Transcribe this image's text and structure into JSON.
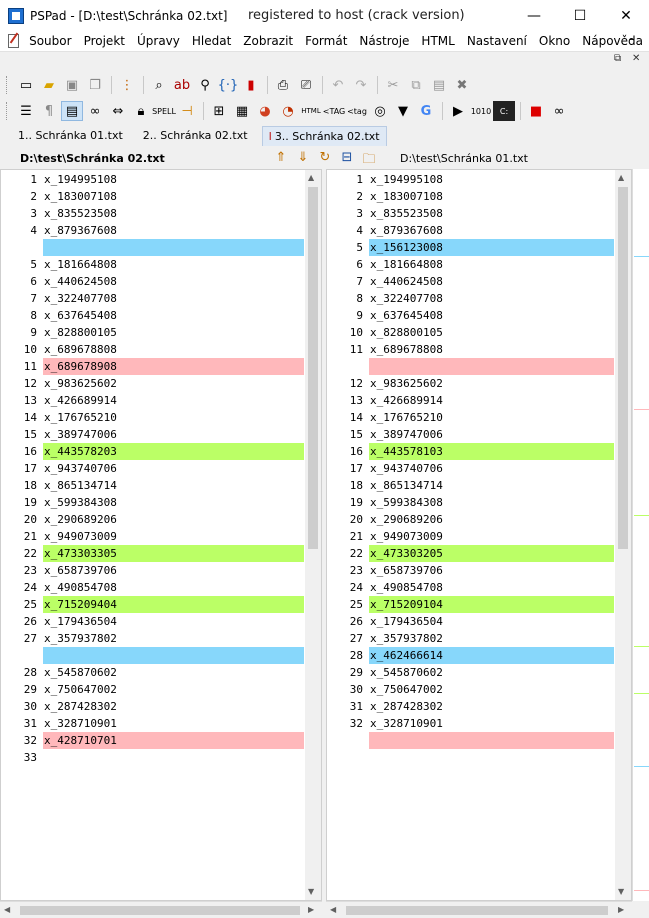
{
  "window": {
    "title": "PSPad - [D:\\test\\Schránka 02.txt]",
    "title_center": "registered to host (crack version)",
    "minimize_glyph": "—",
    "maximize_glyph": "☐",
    "close_glyph": "✕"
  },
  "menu": {
    "items": [
      "Soubor",
      "Projekt",
      "Úpravy",
      "Hledat",
      "Zobrazit",
      "Formát",
      "Nástroje",
      "HTML",
      "Nastavení",
      "Okno",
      "Nápověda"
    ],
    "mdi_min": "–"
  },
  "tabs": [
    {
      "label": "1.. Schránka 01.txt",
      "active": false
    },
    {
      "label": "2.. Schránka 02.txt",
      "active": false
    },
    {
      "label": "3.. Schránka 02.txt",
      "active": true
    }
  ],
  "paths": {
    "left": "D:\\test\\Schránka 02.txt",
    "right": "D:\\test\\Schránka 01.txt"
  },
  "colors": {
    "blue": "#87d7fb",
    "red": "#ffb8bb",
    "green": "#bbff66"
  },
  "left_lines": [
    {
      "n": "1",
      "t": "x_194995108",
      "hl": ""
    },
    {
      "n": "2",
      "t": "x_183007108",
      "hl": ""
    },
    {
      "n": "3",
      "t": "x_835523508",
      "hl": ""
    },
    {
      "n": "4",
      "t": "x_879367608",
      "hl": ""
    },
    {
      "n": "",
      "t": "",
      "hl": "blue"
    },
    {
      "n": "5",
      "t": "x_181664808",
      "hl": ""
    },
    {
      "n": "6",
      "t": "x_440624508",
      "hl": ""
    },
    {
      "n": "7",
      "t": "x_322407708",
      "hl": ""
    },
    {
      "n": "8",
      "t": "x_637645408",
      "hl": ""
    },
    {
      "n": "9",
      "t": "x_828800105",
      "hl": ""
    },
    {
      "n": "10",
      "t": "x_689678808",
      "hl": ""
    },
    {
      "n": "11",
      "t": "x_689678908",
      "hl": "red"
    },
    {
      "n": "12",
      "t": "x_983625602",
      "hl": ""
    },
    {
      "n": "13",
      "t": "x_426689914",
      "hl": ""
    },
    {
      "n": "14",
      "t": "x_176765210",
      "hl": ""
    },
    {
      "n": "15",
      "t": "x_389747006",
      "hl": ""
    },
    {
      "n": "16",
      "t": "x_443578203",
      "hl": "green"
    },
    {
      "n": "17",
      "t": "x_943740706",
      "hl": ""
    },
    {
      "n": "18",
      "t": "x_865134714",
      "hl": ""
    },
    {
      "n": "19",
      "t": "x_599384308",
      "hl": ""
    },
    {
      "n": "20",
      "t": "x_290689206",
      "hl": ""
    },
    {
      "n": "21",
      "t": "x_949073009",
      "hl": ""
    },
    {
      "n": "22",
      "t": "x_473303305",
      "hl": "green"
    },
    {
      "n": "23",
      "t": "x_658739706",
      "hl": ""
    },
    {
      "n": "24",
      "t": "x_490854708",
      "hl": ""
    },
    {
      "n": "25",
      "t": "x_715209404",
      "hl": "green"
    },
    {
      "n": "26",
      "t": "x_179436504",
      "hl": ""
    },
    {
      "n": "27",
      "t": "x_357937802",
      "hl": ""
    },
    {
      "n": "",
      "t": "",
      "hl": "blue"
    },
    {
      "n": "28",
      "t": "x_545870602",
      "hl": ""
    },
    {
      "n": "29",
      "t": "x_750647002",
      "hl": ""
    },
    {
      "n": "30",
      "t": "x_287428302",
      "hl": ""
    },
    {
      "n": "31",
      "t": "x_328710901",
      "hl": ""
    },
    {
      "n": "32",
      "t": "x_428710701",
      "hl": "red"
    },
    {
      "n": "33",
      "t": "",
      "hl": ""
    }
  ],
  "right_lines": [
    {
      "n": "1",
      "t": "x_194995108",
      "hl": ""
    },
    {
      "n": "2",
      "t": "x_183007108",
      "hl": ""
    },
    {
      "n": "3",
      "t": "x_835523508",
      "hl": ""
    },
    {
      "n": "4",
      "t": "x_879367608",
      "hl": ""
    },
    {
      "n": "5",
      "t": "x_156123008",
      "hl": "blue"
    },
    {
      "n": "6",
      "t": "x_181664808",
      "hl": ""
    },
    {
      "n": "7",
      "t": "x_440624508",
      "hl": ""
    },
    {
      "n": "8",
      "t": "x_322407708",
      "hl": ""
    },
    {
      "n": "9",
      "t": "x_637645408",
      "hl": ""
    },
    {
      "n": "10",
      "t": "x_828800105",
      "hl": ""
    },
    {
      "n": "11",
      "t": "x_689678808",
      "hl": ""
    },
    {
      "n": "",
      "t": "",
      "hl": "red"
    },
    {
      "n": "12",
      "t": "x_983625602",
      "hl": ""
    },
    {
      "n": "13",
      "t": "x_426689914",
      "hl": ""
    },
    {
      "n": "14",
      "t": "x_176765210",
      "hl": ""
    },
    {
      "n": "15",
      "t": "x_389747006",
      "hl": ""
    },
    {
      "n": "16",
      "t": "x_443578103",
      "hl": "green"
    },
    {
      "n": "17",
      "t": "x_943740706",
      "hl": ""
    },
    {
      "n": "18",
      "t": "x_865134714",
      "hl": ""
    },
    {
      "n": "19",
      "t": "x_599384308",
      "hl": ""
    },
    {
      "n": "20",
      "t": "x_290689206",
      "hl": ""
    },
    {
      "n": "21",
      "t": "x_949073009",
      "hl": ""
    },
    {
      "n": "22",
      "t": "x_473303205",
      "hl": "green"
    },
    {
      "n": "23",
      "t": "x_658739706",
      "hl": ""
    },
    {
      "n": "24",
      "t": "x_490854708",
      "hl": ""
    },
    {
      "n": "25",
      "t": "x_715209104",
      "hl": "green"
    },
    {
      "n": "26",
      "t": "x_179436504",
      "hl": ""
    },
    {
      "n": "27",
      "t": "x_357937802",
      "hl": ""
    },
    {
      "n": "28",
      "t": "x_462466614",
      "hl": "blue"
    },
    {
      "n": "29",
      "t": "x_545870602",
      "hl": ""
    },
    {
      "n": "30",
      "t": "x_750647002",
      "hl": ""
    },
    {
      "n": "31",
      "t": "x_287428302",
      "hl": ""
    },
    {
      "n": "32",
      "t": "x_328710901",
      "hl": ""
    },
    {
      "n": "",
      "t": "",
      "hl": "red"
    }
  ],
  "overview_marks": [
    {
      "pos": 0.12,
      "color": "blue"
    },
    {
      "pos": 0.33,
      "color": "red"
    },
    {
      "pos": 0.475,
      "color": "green"
    },
    {
      "pos": 0.655,
      "color": "green"
    },
    {
      "pos": 0.72,
      "color": "green"
    },
    {
      "pos": 0.82,
      "color": "blue"
    },
    {
      "pos": 0.99,
      "color": "red"
    }
  ],
  "scroll": {
    "vthumb_fraction": 0.52
  }
}
